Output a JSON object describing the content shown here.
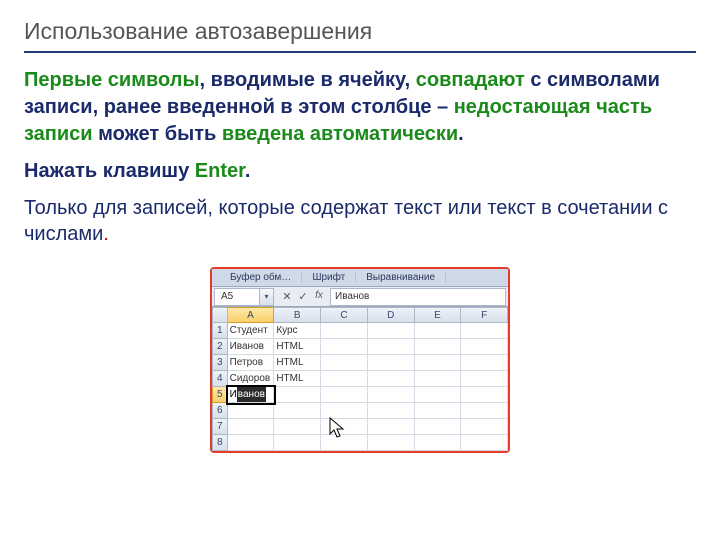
{
  "title": "Использование автозавершения",
  "para1": {
    "p1": "Первые символы",
    "p2": ", вводимые в ячейку, ",
    "p3": "совпадают",
    "p4": " с символами записи, ранее введенной в этом столбце –  ",
    "p5": "недостающая часть записи",
    "p6": " может быть ",
    "p7": "введена автоматически",
    "p8": "."
  },
  "para2": {
    "p1": "Нажать клавишу ",
    "p2": "Enter",
    "p3": "."
  },
  "note": {
    "text": "Только для записей, которые содержат текст или текст в сочетании с числами",
    "period": "."
  },
  "excel": {
    "ribbon": {
      "buf": "Буфер обм…",
      "font": "Шрифт",
      "align": "Выравнивание"
    },
    "namebox": "A5",
    "formula": "Иванов",
    "cols": [
      "A",
      "B",
      "C",
      "D",
      "E",
      "F"
    ],
    "rows": [
      {
        "n": "1",
        "a": "Студент",
        "b": "Курс"
      },
      {
        "n": "2",
        "a": "Иванов",
        "b": "HTML"
      },
      {
        "n": "3",
        "a": "Петров",
        "b": "HTML"
      },
      {
        "n": "4",
        "a": "Сидоров",
        "b": "HTML"
      },
      {
        "n": "5",
        "typed": "И",
        "suggest": "ванов"
      },
      {
        "n": "6"
      },
      {
        "n": "7"
      },
      {
        "n": "8"
      }
    ]
  }
}
